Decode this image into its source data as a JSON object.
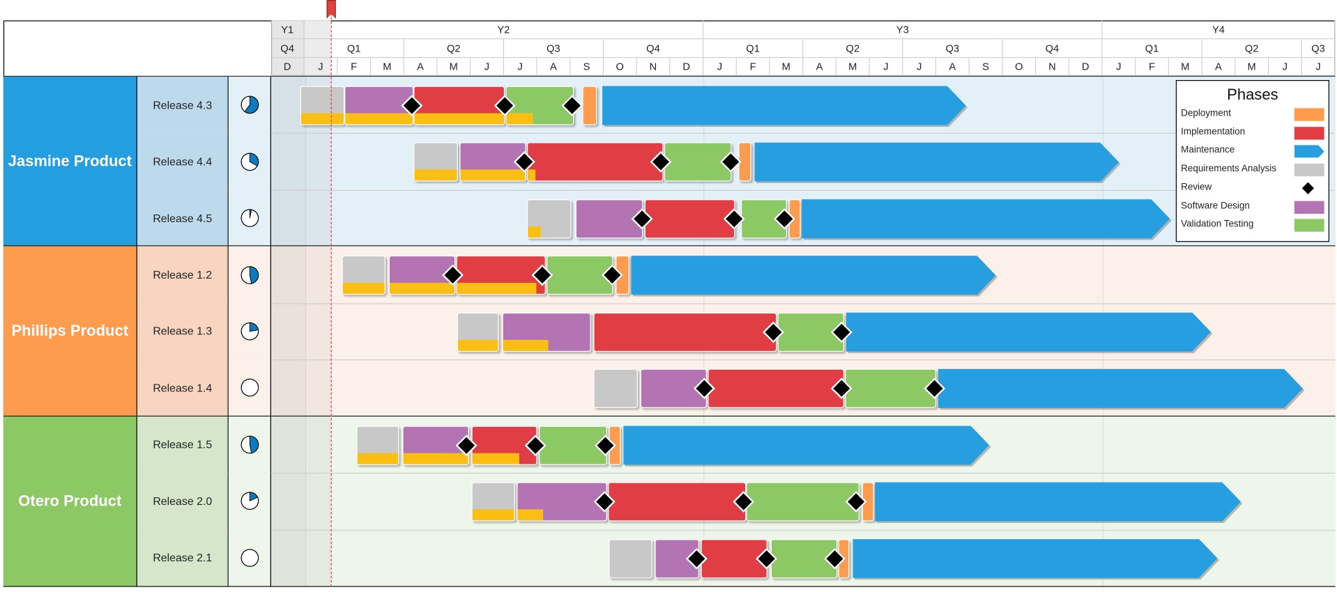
{
  "colors": {
    "requirements": "#c8c8c8",
    "design": "#b474b4",
    "implementation": "#e03e44",
    "testing": "#8cc864",
    "deployment": "#fd9b4f",
    "maintenance": "#269edf",
    "progress": "#fbbf14",
    "review": "#000000",
    "today_line": "#e0413a",
    "pie_fill": "#0a7cc4"
  },
  "header": {
    "years": [
      {
        "label": "Y1",
        "months": 1
      },
      {
        "label": "Y2",
        "months": 12
      },
      {
        "label": "Y3",
        "months": 12
      },
      {
        "label": "Y4",
        "months": 7
      }
    ],
    "quarters": [
      {
        "label": "Q4",
        "months": 1
      },
      {
        "label": "Q1",
        "months": 3
      },
      {
        "label": "Q2",
        "months": 3
      },
      {
        "label": "Q3",
        "months": 3
      },
      {
        "label": "Q4",
        "months": 3
      },
      {
        "label": "Q1",
        "months": 3
      },
      {
        "label": "Q2",
        "months": 3
      },
      {
        "label": "Q3",
        "months": 3
      },
      {
        "label": "Q4",
        "months": 3
      },
      {
        "label": "Q1",
        "months": 3
      },
      {
        "label": "Q2",
        "months": 3
      },
      {
        "label": "Q3",
        "months": 1
      }
    ],
    "months": [
      "D",
      "J",
      "F",
      "M",
      "A",
      "M",
      "J",
      "J",
      "A",
      "S",
      "O",
      "N",
      "D",
      "J",
      "F",
      "M",
      "A",
      "M",
      "J",
      "J",
      "A",
      "S",
      "O",
      "N",
      "D",
      "J",
      "F",
      "M",
      "A",
      "M",
      "J",
      "J"
    ]
  },
  "today": "Y2-01-24",
  "legend": {
    "title": "Phases",
    "items": [
      {
        "label": "Deployment",
        "phase": "deployment"
      },
      {
        "label": "Implementation",
        "phase": "implementation"
      },
      {
        "label": "Maintenance",
        "phase": "maintenance"
      },
      {
        "label": "Requirements Analysis",
        "phase": "requirements"
      },
      {
        "label": "Review",
        "phase": "review"
      },
      {
        "label": "Software Design",
        "phase": "design"
      },
      {
        "label": "Validation Testing",
        "phase": "testing"
      }
    ]
  },
  "products": [
    {
      "name": "Jasmine Product",
      "color": "#249ede",
      "release_bg": "#bcdaec",
      "row_bg": "#e4f0f7",
      "pie_bg": "#e4f0f7",
      "releases": [
        {
          "name": "Release 4.3",
          "complete": 0.6,
          "phases": [
            {
              "phase": "requirements",
              "start": "Y1-12-26",
              "end": "Y2-02-06",
              "progress": 1
            },
            {
              "phase": "design",
              "start": "Y2-02-06",
              "end": "Y2-04-09",
              "progress": 1
            },
            {
              "phase": "implementation",
              "start": "Y2-04-09",
              "end": "Y2-07-01",
              "progress": 1
            },
            {
              "phase": "testing",
              "start": "Y2-07-02",
              "end": "Y2-09-03",
              "progress": 0.4
            },
            {
              "phase": "deployment",
              "start": "Y2-09-11",
              "end": "Y2-09-24",
              "progress": 0
            },
            {
              "phase": "maintenance",
              "start": "Y2-09-29",
              "end": "Y3-08-27",
              "progress": 0
            }
          ],
          "reviews": [
            "Y2-04-07",
            "Y2-07-01",
            "Y2-09-02"
          ]
        },
        {
          "name": "Release 4.4",
          "complete": 0.33,
          "phases": [
            {
              "phase": "requirements",
              "start": "Y2-04-09",
              "end": "Y2-05-19",
              "progress": 1
            },
            {
              "phase": "design",
              "start": "Y2-05-20",
              "end": "Y2-07-20",
              "progress": 1
            },
            {
              "phase": "implementation",
              "start": "Y2-07-21",
              "end": "Y2-11-24",
              "progress": 0.06
            },
            {
              "phase": "testing",
              "start": "Y2-11-25",
              "end": "Y3-01-26",
              "progress": 0
            },
            {
              "phase": "deployment",
              "start": "Y3-02-02",
              "end": "Y3-02-13",
              "progress": 0
            },
            {
              "phase": "maintenance",
              "start": "Y3-02-16",
              "end": "Y4-01-15",
              "progress": 0
            }
          ],
          "reviews": [
            "Y2-07-19",
            "Y2-11-22",
            "Y3-01-25"
          ]
        },
        {
          "name": "Release 4.5",
          "complete": 0.03,
          "phases": [
            {
              "phase": "requirements",
              "start": "Y2-07-21",
              "end": "Y2-09-01",
              "progress": 0.29
            },
            {
              "phase": "design",
              "start": "Y2-09-05",
              "end": "Y2-11-06",
              "progress": 0
            },
            {
              "phase": "implementation",
              "start": "Y2-11-07",
              "end": "Y3-01-29",
              "progress": 0
            },
            {
              "phase": "testing",
              "start": "Y3-02-04",
              "end": "Y3-03-16",
              "progress": 0
            },
            {
              "phase": "deployment",
              "start": "Y3-03-17",
              "end": "Y3-03-28",
              "progress": 0
            },
            {
              "phase": "maintenance",
              "start": "Y3-03-29",
              "end": "Y4-03-01",
              "progress": 0
            }
          ],
          "reviews": [
            "Y2-11-05",
            "Y3-01-28",
            "Y3-03-13"
          ]
        }
      ]
    },
    {
      "name": "Phillips Product",
      "color": "#fd9b4f",
      "release_bg": "#f8d5c0",
      "row_bg": "#fcf1ea",
      "pie_bg": "#fcf1ea",
      "releases": [
        {
          "name": "Release 1.2",
          "complete": 0.47,
          "phases": [
            {
              "phase": "requirements",
              "start": "Y2-02-04",
              "end": "Y2-03-13",
              "progress": 1
            },
            {
              "phase": "design",
              "start": "Y2-03-16",
              "end": "Y2-05-16",
              "progress": 1
            },
            {
              "phase": "implementation",
              "start": "Y2-05-17",
              "end": "Y2-08-08",
              "progress": 0.9
            },
            {
              "phase": "testing",
              "start": "Y2-08-09",
              "end": "Y2-10-09",
              "progress": 0
            },
            {
              "phase": "deployment",
              "start": "Y2-10-11",
              "end": "Y2-10-23",
              "progress": 0
            },
            {
              "phase": "maintenance",
              "start": "Y2-10-25",
              "end": "Y3-09-24",
              "progress": 0
            }
          ],
          "reviews": [
            "Y2-05-14",
            "Y2-08-05",
            "Y2-10-08"
          ]
        },
        {
          "name": "Release 1.3",
          "complete": 0.22,
          "phases": [
            {
              "phase": "requirements",
              "start": "Y2-05-18",
              "end": "Y2-06-26",
              "progress": 1
            },
            {
              "phase": "design",
              "start": "Y2-06-29",
              "end": "Y2-09-19",
              "progress": 0.52
            },
            {
              "phase": "implementation",
              "start": "Y2-09-21",
              "end": "Y3-03-06",
              "progress": 0
            },
            {
              "phase": "testing",
              "start": "Y3-03-07",
              "end": "Y3-05-07",
              "progress": 0
            },
            {
              "phase": "maintenance",
              "start": "Y3-05-09",
              "end": "Y4-04-08",
              "progress": 0
            }
          ],
          "reviews": [
            "Y3-03-03",
            "Y3-05-05"
          ]
        },
        {
          "name": "Release 1.4",
          "complete": 0,
          "phases": [
            {
              "phase": "requirements",
              "start": "Y2-09-21",
              "end": "Y2-11-01",
              "progress": 0
            },
            {
              "phase": "design",
              "start": "Y2-11-03",
              "end": "Y3-01-03",
              "progress": 0
            },
            {
              "phase": "implementation",
              "start": "Y3-01-04",
              "end": "Y3-05-07",
              "progress": 0
            },
            {
              "phase": "testing",
              "start": "Y3-05-08",
              "end": "Y3-07-30",
              "progress": 0
            },
            {
              "phase": "maintenance",
              "start": "Y3-08-02",
              "end": "Y4-07-01",
              "progress": 0
            }
          ],
          "reviews": [
            "Y3-01-01",
            "Y3-05-05",
            "Y3-07-29"
          ]
        }
      ]
    },
    {
      "name": "Otero Product",
      "color": "#8cc864",
      "release_bg": "#d5e6cb",
      "row_bg": "#eef5ea",
      "pie_bg": "#eef5ea",
      "releases": [
        {
          "name": "Release 1.5",
          "complete": 0.47,
          "phases": [
            {
              "phase": "requirements",
              "start": "Y2-02-17",
              "end": "Y2-03-26",
              "progress": 1
            },
            {
              "phase": "design",
              "start": "Y2-03-29",
              "end": "Y2-05-29",
              "progress": 1
            },
            {
              "phase": "implementation",
              "start": "Y2-06-01",
              "end": "Y2-07-30",
              "progress": 0.73
            },
            {
              "phase": "testing",
              "start": "Y2-08-02",
              "end": "Y2-10-03",
              "progress": 0
            },
            {
              "phase": "deployment",
              "start": "Y2-10-05",
              "end": "Y2-10-16",
              "progress": 0
            },
            {
              "phase": "maintenance",
              "start": "Y2-10-18",
              "end": "Y3-09-18",
              "progress": 0
            }
          ],
          "reviews": [
            "Y2-05-26",
            "Y2-07-29",
            "Y2-10-02"
          ]
        },
        {
          "name": "Release 2.0",
          "complete": 0.18,
          "phases": [
            {
              "phase": "requirements",
              "start": "Y2-06-01",
              "end": "Y2-07-10",
              "progress": 1
            },
            {
              "phase": "design",
              "start": "Y2-07-12",
              "end": "Y2-10-03",
              "progress": 0.29
            },
            {
              "phase": "implementation",
              "start": "Y2-10-04",
              "end": "Y3-02-09",
              "progress": 0
            },
            {
              "phase": "testing",
              "start": "Y3-02-09",
              "end": "Y3-05-21",
              "progress": 0
            },
            {
              "phase": "deployment",
              "start": "Y3-05-23",
              "end": "Y3-06-04",
              "progress": 0
            },
            {
              "phase": "maintenance",
              "start": "Y3-06-05",
              "end": "Y4-05-05",
              "progress": 0
            }
          ],
          "reviews": [
            "Y2-10-01",
            "Y3-02-06",
            "Y3-05-18"
          ]
        },
        {
          "name": "Release 2.1",
          "complete": 0,
          "phases": [
            {
              "phase": "requirements",
              "start": "Y2-10-05",
              "end": "Y2-11-14",
              "progress": 0
            },
            {
              "phase": "design",
              "start": "Y2-11-16",
              "end": "Y2-12-26",
              "progress": 0
            },
            {
              "phase": "implementation",
              "start": "Y2-12-28",
              "end": "Y3-02-28",
              "progress": 0
            },
            {
              "phase": "testing",
              "start": "Y3-03-01",
              "end": "Y3-05-01",
              "progress": 0
            },
            {
              "phase": "deployment",
              "start": "Y3-05-02",
              "end": "Y3-05-12",
              "progress": 0
            },
            {
              "phase": "maintenance",
              "start": "Y3-05-15",
              "end": "Y4-04-14",
              "progress": 0
            }
          ],
          "reviews": [
            "Y2-12-24",
            "Y3-02-27",
            "Y3-04-29"
          ]
        }
      ]
    }
  ]
}
